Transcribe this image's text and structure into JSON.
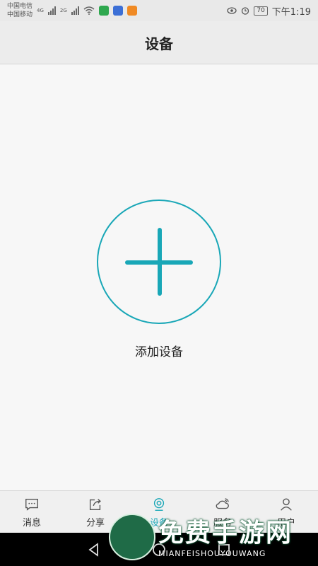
{
  "status_bar": {
    "carrier1": "中国电信",
    "carrier2": "中国移动",
    "net1": "4G",
    "net2": "2G",
    "battery": "70",
    "time": "下午1:19"
  },
  "header": {
    "title": "设备"
  },
  "main": {
    "add_label": "添加设备"
  },
  "tabs": [
    {
      "label": "消息",
      "icon": "message-icon"
    },
    {
      "label": "分享",
      "icon": "share-icon"
    },
    {
      "label": "设备",
      "icon": "device-icon",
      "active": true
    },
    {
      "label": "服务",
      "icon": "cloud-service-icon"
    },
    {
      "label": "用户",
      "icon": "user-icon"
    }
  ],
  "watermark": {
    "text": "免费手游网",
    "sub": "MIANFEISHOUYOUWANG"
  },
  "colors": {
    "accent": "#19a7b7"
  }
}
